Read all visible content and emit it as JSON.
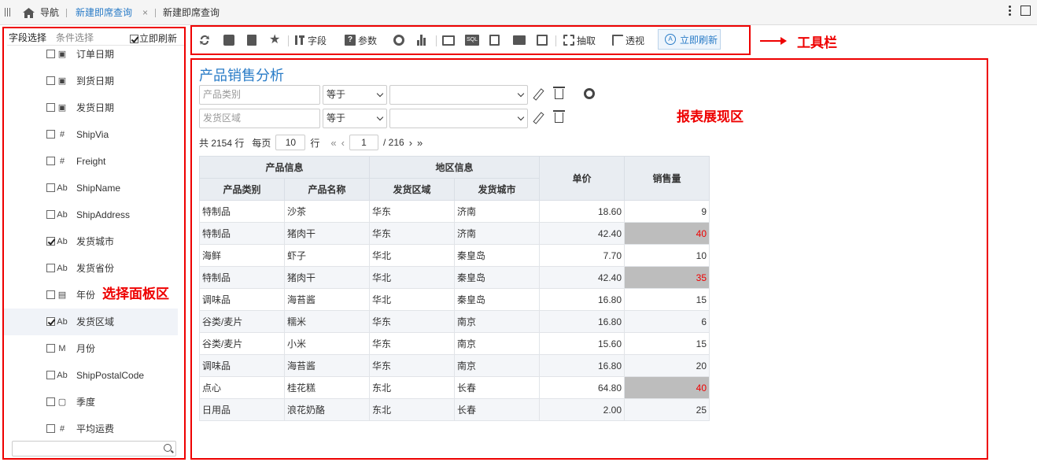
{
  "topbar": {
    "nav_label": "导航",
    "active_tab": "新建即席查询",
    "close_glyph": "×",
    "second_tab": "新建即席查询",
    "icons": [
      "home-icon",
      "more-icon",
      "maximize-icon"
    ]
  },
  "left_panel": {
    "tabs": [
      "字段选择",
      "条件选择"
    ],
    "auto_refresh_label": "立即刷新",
    "auto_refresh_checked": true,
    "fields": [
      {
        "label": "订单日期",
        "type": "date",
        "checked": false
      },
      {
        "label": "到货日期",
        "type": "date",
        "checked": false
      },
      {
        "label": "发货日期",
        "type": "date",
        "checked": false
      },
      {
        "label": "ShipVia",
        "type": "number",
        "checked": false
      },
      {
        "label": "Freight",
        "type": "number",
        "checked": false
      },
      {
        "label": "ShipName",
        "type": "text",
        "checked": false
      },
      {
        "label": "ShipAddress",
        "type": "text",
        "checked": false
      },
      {
        "label": "发货城市",
        "type": "text",
        "checked": true
      },
      {
        "label": "发货省份",
        "type": "text",
        "checked": false
      },
      {
        "label": "年份",
        "type": "year",
        "checked": false
      },
      {
        "label": "发货区域",
        "type": "text",
        "checked": true,
        "selected": true
      },
      {
        "label": "月份",
        "type": "month",
        "checked": false
      },
      {
        "label": "ShipPostalCode",
        "type": "text",
        "checked": false
      },
      {
        "label": "季度",
        "type": "quarter",
        "checked": false
      },
      {
        "label": "平均运费",
        "type": "number",
        "checked": false
      }
    ],
    "search_placeholder": ""
  },
  "annotations": {
    "panel": "选择面板区",
    "toolbar": "工具栏",
    "report": "报表展现区"
  },
  "toolbar": {
    "field_label": "字段",
    "param_label": "参数",
    "extract_label": "抽取",
    "pivot_label": "透视",
    "refresh_label": "立即刷新",
    "sql_label": "SQL"
  },
  "report": {
    "title": "产品销售分析",
    "filters": [
      {
        "field": "产品类别",
        "op": "等于",
        "value": ""
      },
      {
        "field": "发货区域",
        "op": "等于",
        "value": ""
      }
    ],
    "pager": {
      "total_label": "共 2154 行",
      "per_page_label": "每页",
      "per_page": "10",
      "rows_label": "行",
      "page": "1",
      "total_pages": "/ 216"
    },
    "headers": {
      "group1": "产品信息",
      "group2": "地区信息",
      "price": "单价",
      "qty": "销售量",
      "cols": [
        "产品类别",
        "产品名称",
        "发货区域",
        "发货城市"
      ]
    },
    "rows": [
      {
        "cat": "特制品",
        "name": "沙茶",
        "region": "华东",
        "city": "济南",
        "price": "18.60",
        "qty": "9",
        "hl": false
      },
      {
        "cat": "特制品",
        "name": "猪肉干",
        "region": "华东",
        "city": "济南",
        "price": "42.40",
        "qty": "40",
        "hl": true
      },
      {
        "cat": "海鲜",
        "name": "虾子",
        "region": "华北",
        "city": "秦皇岛",
        "price": "7.70",
        "qty": "10",
        "hl": false
      },
      {
        "cat": "特制品",
        "name": "猪肉干",
        "region": "华北",
        "city": "秦皇岛",
        "price": "42.40",
        "qty": "35",
        "hl": true
      },
      {
        "cat": "调味品",
        "name": "海苔酱",
        "region": "华北",
        "city": "秦皇岛",
        "price": "16.80",
        "qty": "15",
        "hl": false
      },
      {
        "cat": "谷类/麦片",
        "name": "糯米",
        "region": "华东",
        "city": "南京",
        "price": "16.80",
        "qty": "6",
        "hl": false
      },
      {
        "cat": "谷类/麦片",
        "name": "小米",
        "region": "华东",
        "city": "南京",
        "price": "15.60",
        "qty": "15",
        "hl": false
      },
      {
        "cat": "调味品",
        "name": "海苔酱",
        "region": "华东",
        "city": "南京",
        "price": "16.80",
        "qty": "20",
        "hl": false
      },
      {
        "cat": "点心",
        "name": "桂花糕",
        "region": "东北",
        "city": "长春",
        "price": "64.80",
        "qty": "40",
        "hl": true
      },
      {
        "cat": "日用品",
        "name": "浪花奶酪",
        "region": "东北",
        "city": "长春",
        "price": "2.00",
        "qty": "25",
        "hl": false
      }
    ],
    "highlight_color": "#bdbdbd",
    "highlight_text_color": "#e00000"
  }
}
